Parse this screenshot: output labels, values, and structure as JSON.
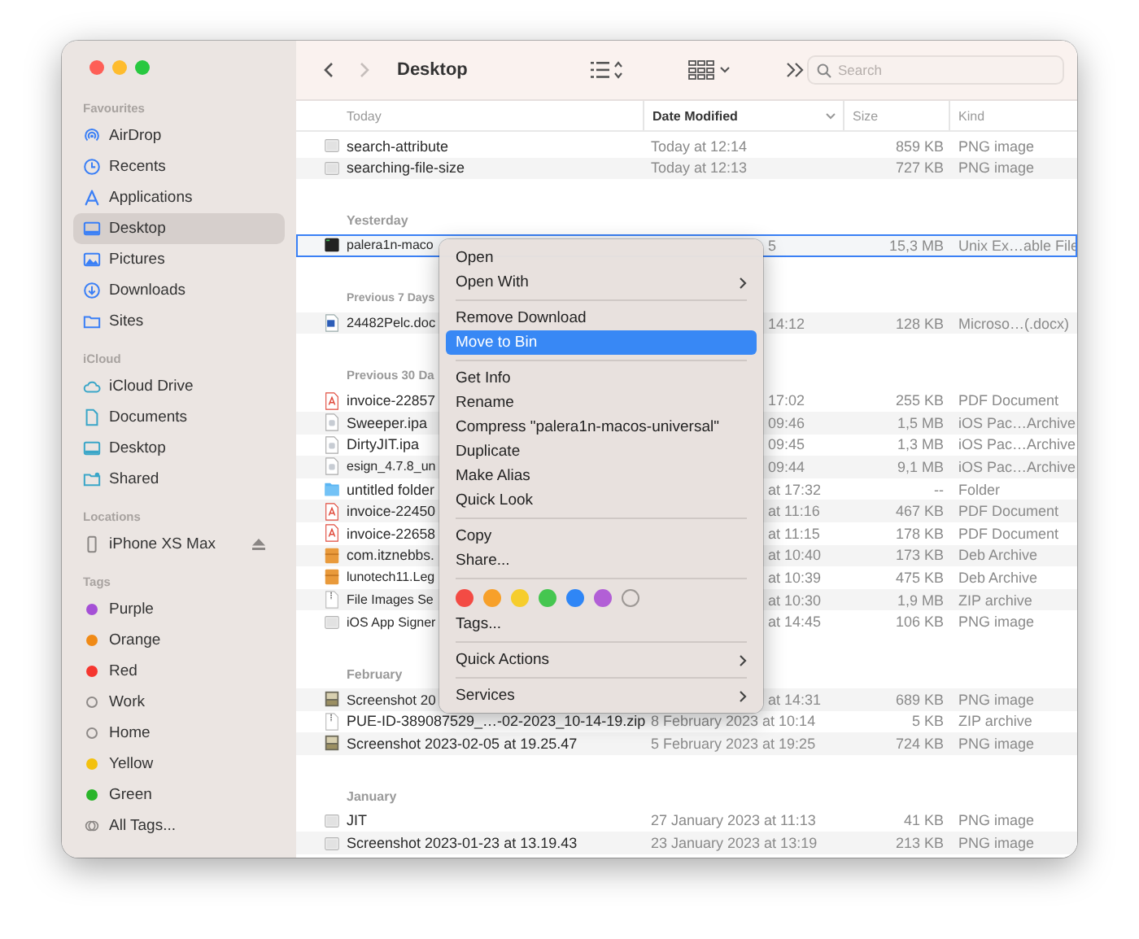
{
  "window": {
    "title": "Desktop",
    "back": {
      "disabled": false
    },
    "forward": {
      "disabled": true
    }
  },
  "search": {
    "placeholder": "Search"
  },
  "sidebar": {
    "sections": [
      {
        "heading": "Favourites",
        "items": [
          {
            "label": "AirDrop",
            "kind": "airdrop",
            "selected": false
          },
          {
            "label": "Recents",
            "kind": "clock",
            "selected": false
          },
          {
            "label": "Applications",
            "kind": "apps",
            "selected": false
          },
          {
            "label": "Desktop",
            "kind": "desktop",
            "selected": true
          },
          {
            "label": "Pictures",
            "kind": "pictures",
            "selected": false
          },
          {
            "label": "Downloads",
            "kind": "downloads",
            "selected": false
          },
          {
            "label": "Sites",
            "kind": "folder",
            "selected": false
          }
        ]
      },
      {
        "heading": "iCloud",
        "items": [
          {
            "label": "iCloud Drive",
            "kind": "cloud",
            "selected": false
          },
          {
            "label": "Documents",
            "kind": "document",
            "selected": false
          },
          {
            "label": "Desktop",
            "kind": "cloud-desktop",
            "selected": false
          },
          {
            "label": "Shared",
            "kind": "shared",
            "selected": false
          }
        ]
      },
      {
        "heading": "Locations",
        "items": [
          {
            "label": "iPhone XS Max",
            "kind": "phone",
            "selected": false
          }
        ]
      },
      {
        "heading": "Tags",
        "items": [
          {
            "label": "Purple",
            "kind": "tag",
            "color": "#a550d6",
            "selected": false
          },
          {
            "label": "Orange",
            "kind": "tag",
            "color": "#f08a16",
            "selected": false
          },
          {
            "label": "Red",
            "kind": "tag",
            "color": "#f5362f",
            "selected": false
          },
          {
            "label": "Work",
            "kind": "tag",
            "selected": false
          },
          {
            "label": "Home",
            "kind": "tag",
            "selected": false
          },
          {
            "label": "Yellow",
            "kind": "tag",
            "color": "#f3c10e",
            "selected": false
          },
          {
            "label": "Green",
            "kind": "tag",
            "color": "#2ab52a",
            "selected": false
          },
          {
            "label": "All Tags...",
            "kind": "all-tags",
            "selected": false
          }
        ]
      }
    ]
  },
  "table": {
    "columns": [
      {
        "label": "Today",
        "sorted": false
      },
      {
        "label": "Date Modified",
        "sorted": true
      },
      {
        "label": "Size",
        "sorted": false
      },
      {
        "label": "Kind",
        "sorted": false
      }
    ],
    "sections": [
      {
        "rows": [
          {
            "kind": "image",
            "name": "search-attribute",
            "date": "Today at 12:14",
            "size": "859 KB",
            "type": "PNG image",
            "selected": false
          },
          {
            "kind": "image",
            "name": "searching-file-size",
            "date": "Today at 12:13",
            "size": "727 KB",
            "type": "PNG image",
            "selected": false
          }
        ]
      },
      {
        "label": "Yesterday",
        "rows": [
          {
            "kind": "terminal",
            "name": "palera1n-maco",
            "date": "5",
            "size": "15,3 MB",
            "type": "Unix Ex…able File",
            "selected": true
          }
        ]
      },
      {
        "label": "Previous 7 Days",
        "rows": [
          {
            "kind": "word",
            "name": "24482Pelc.doc",
            "date": "14:12",
            "size": "128 KB",
            "type": "Microso…(.docx)",
            "selected": false
          }
        ]
      },
      {
        "label": "Previous 30 Da",
        "rows": [
          {
            "kind": "pdf",
            "name": "invoice-22857",
            "date": "17:02",
            "size": "255 KB",
            "type": "PDF Document",
            "selected": false
          },
          {
            "kind": "ipa",
            "name": "Sweeper.ipa",
            "date": "09:46",
            "size": "1,5 MB",
            "type": "iOS Pac…Archive",
            "selected": false
          },
          {
            "kind": "ipa",
            "name": "DirtyJIT.ipa",
            "date": "09:45",
            "size": "1,3 MB",
            "type": "iOS Pac…Archive",
            "selected": false
          },
          {
            "kind": "ipa",
            "name": "esign_4.7.8_un",
            "date": "09:44",
            "size": "9,1 MB",
            "type": "iOS Pac…Archive",
            "selected": false
          },
          {
            "kind": "folder",
            "name": "untitled folder",
            "date": "at 17:32",
            "size": "--",
            "type": "Folder",
            "selected": false
          },
          {
            "kind": "pdf",
            "name": "invoice-22450",
            "date": "at 11:16",
            "size": "467 KB",
            "type": "PDF Document",
            "selected": false
          },
          {
            "kind": "pdf",
            "name": "invoice-22658",
            "date": "at 11:15",
            "size": "178 KB",
            "type": "PDF Document",
            "selected": false
          },
          {
            "kind": "deb",
            "name": "com.itznebbs.",
            "date": "at 10:40",
            "size": "173 KB",
            "type": "Deb Archive",
            "selected": false
          },
          {
            "kind": "deb",
            "name": "lunotech11.Leg",
            "date": "at 10:39",
            "size": "475 KB",
            "type": "Deb Archive",
            "selected": false
          },
          {
            "kind": "zip",
            "name": "File Images Se",
            "date": "at 10:30",
            "size": "1,9 MB",
            "type": "ZIP archive",
            "selected": false
          },
          {
            "kind": "image",
            "name": "iOS App Signer",
            "date": "at 14:45",
            "size": "106 KB",
            "type": "PNG image",
            "selected": false
          }
        ]
      },
      {
        "label": "February",
        "rows": [
          {
            "kind": "thumbnail",
            "name": "Screenshot 20",
            "date": "at 14:31",
            "size": "689 KB",
            "type": "PNG image",
            "selected": false
          },
          {
            "kind": "zip",
            "name": "PUE-ID-389087529_…-02-2023_10-14-19.zip",
            "date": "8 February 2023 at 10:14",
            "size": "5 KB",
            "type": "ZIP archive",
            "selected": false
          },
          {
            "kind": "thumbnail",
            "name": "Screenshot 2023-02-05 at 19.25.47",
            "date": "5 February 2023 at 19:25",
            "size": "724 KB",
            "type": "PNG image",
            "selected": false
          }
        ]
      },
      {
        "label": "January",
        "rows": [
          {
            "kind": "image",
            "name": "JIT",
            "date": "27 January 2023 at 11:13",
            "size": "41 KB",
            "type": "PNG image",
            "selected": false
          },
          {
            "kind": "image",
            "name": "Screenshot 2023-01-23 at 13.19.43",
            "date": "23 January 2023 at 13:19",
            "size": "213 KB",
            "type": "PNG image",
            "selected": false
          }
        ]
      }
    ]
  },
  "context_menu": {
    "groups": [
      [
        {
          "kind": "item",
          "label": "Open",
          "submenu": false,
          "selected": false
        },
        {
          "kind": "item",
          "label": "Open With",
          "submenu": true,
          "selected": false
        }
      ],
      [
        {
          "kind": "item",
          "label": "Remove Download",
          "submenu": false,
          "selected": false
        },
        {
          "kind": "item",
          "label": "Move to Bin",
          "submenu": false,
          "selected": true
        }
      ],
      [
        {
          "kind": "item",
          "label": "Get Info",
          "submenu": false,
          "selected": false
        },
        {
          "kind": "item",
          "label": "Rename",
          "submenu": false,
          "selected": false
        },
        {
          "kind": "item",
          "label": "Compress \"palera1n-macos-universal\"",
          "submenu": false,
          "selected": false
        },
        {
          "kind": "item",
          "label": "Duplicate",
          "submenu": false,
          "selected": false
        },
        {
          "kind": "item",
          "label": "Make Alias",
          "submenu": false,
          "selected": false
        },
        {
          "kind": "item",
          "label": "Quick Look",
          "submenu": false,
          "selected": false
        }
      ],
      [
        {
          "kind": "item",
          "label": "Copy",
          "submenu": false,
          "selected": false
        },
        {
          "kind": "item",
          "label": "Share...",
          "submenu": false,
          "selected": false
        }
      ],
      [
        {
          "kind": "swatches",
          "colors": [
            {
              "color": "#f34b44"
            },
            {
              "color": "#f7a02a"
            },
            {
              "color": "#f6cd2c"
            },
            {
              "color": "#45c650"
            },
            {
              "color": "#2f86f6"
            },
            {
              "color": "#b25fd6"
            }
          ],
          "no_color_swatch": true
        },
        {
          "kind": "item",
          "label": "Tags...",
          "submenu": false,
          "selected": false
        }
      ],
      [
        {
          "kind": "item",
          "label": "Quick Actions",
          "submenu": true,
          "selected": false
        }
      ],
      [
        {
          "kind": "item",
          "label": "Services",
          "submenu": true,
          "selected": false
        }
      ]
    ]
  }
}
